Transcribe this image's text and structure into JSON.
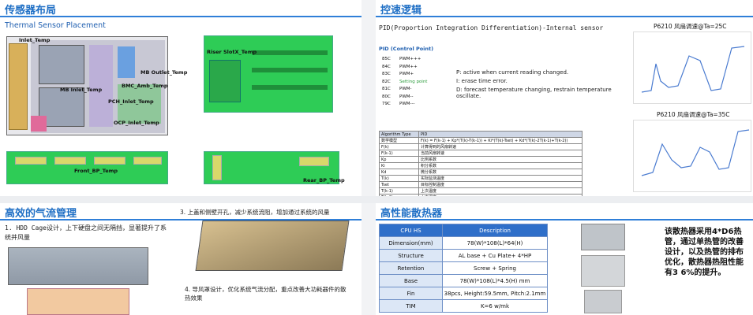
{
  "panels": {
    "sensor": {
      "title": "传感器布局",
      "subtitle": "Thermal Sensor Placement",
      "labels": {
        "inlet": "Inlet_Temp",
        "mb_outlet": "MB Outlet_Temp",
        "bmc_amb": "BMC_Amb_Temp",
        "mb_inlet": "MB Inlet_Temp",
        "pch_inlet": "PCH_Inlet_Temp",
        "ocp_inlet": "OCP_Inlet_Temp",
        "riser": "Riser SlotX_Temp",
        "front_bp": "Front_BP_Temp",
        "rear_bp": "Rear_BP_Temp"
      }
    },
    "speed": {
      "title": "控速逻辑",
      "pid_heading": "PID(Proportion Integration Differentiation)-Internal sensor",
      "cp_title": "PID (Control Point)",
      "cp_rows": [
        {
          "code": "85C",
          "pwm": "PWM+++"
        },
        {
          "code": "84C",
          "pwm": "PWM++"
        },
        {
          "code": "83C",
          "pwm": "PWM+"
        },
        {
          "code": "82C",
          "pwm": "Setting point"
        },
        {
          "code": "81C",
          "pwm": "PWM-"
        },
        {
          "code": "80C",
          "pwm": "PWM--"
        },
        {
          "code": "79C",
          "pwm": "PWM---"
        }
      ],
      "p_line": "P: active when current reading changed.",
      "i_line": "I: erase time error.",
      "d_line": "D: forecast temperature changing, restrain temperature oscillate.",
      "table_rows": [
        [
          "Algorithm Type",
          "PID"
        ],
        [
          "数学模型",
          "F(k) = F(k-1) + Kp*(T(k)-T(k-1)) + Ki*(T(k)-Tset) + Kd*(T(k)-2T(k-1)+T(k-2))"
        ],
        [
          "F(k)",
          "计算得到的风扇转速"
        ],
        [
          "F(k-1)",
          "当前风扇转速"
        ],
        [
          "Kp",
          "比例系数"
        ],
        [
          "Ki",
          "积分系数"
        ],
        [
          "Kd",
          "微分系数"
        ],
        [
          "T(k)",
          "实际监测温度"
        ],
        [
          "Tset",
          "目标控制温度"
        ],
        [
          "T(k-1)",
          "上次温度"
        ],
        [
          "T(k-2)",
          "上次温度"
        ]
      ],
      "chart1_title": "P6210 风扇调速@Ta=25C",
      "chart2_title": "P6210 风扇调速@Ta=35C"
    },
    "airflow": {
      "title": "高效的气流管理",
      "note1": "1. HDD Cage设计，上下硬盘之间无隔挡，显著提升了系统并风量",
      "note3": "3. 上盖和侧壁开孔，减少系统流阻，增加通过系统的风量",
      "note4": "4. 导风罩设计，优化系统气流分配，重点改善大功耗器件的散热效果"
    },
    "heatsink": {
      "title": "高性能散热器",
      "table_header": [
        "CPU HS",
        "Description"
      ],
      "rows": [
        [
          "Dimension(mm)",
          "78(W)*108(L)*64(H)"
        ],
        [
          "Structure",
          "AL base + Cu Plate+ 4*HP"
        ],
        [
          "Retention",
          "Screw + Spring"
        ],
        [
          "Base",
          "78(W)*108(L)*4.5(H) mm"
        ],
        [
          "Fin",
          "38pcs, Height:59.5mm, Pitch:2.1mm"
        ],
        [
          "TIM",
          "K=6 w/mk"
        ]
      ],
      "desc": "该散热器采用4*D6热管，通过单热管的改善设计，以及热管的排布优化，散热器热阻性能有3 6%的提升。"
    }
  }
}
